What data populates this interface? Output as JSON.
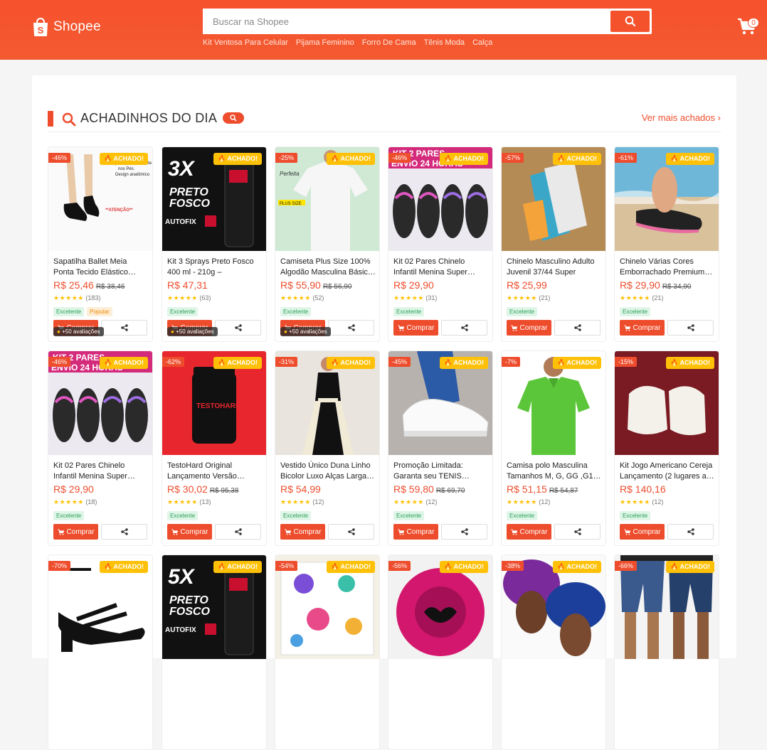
{
  "header": {
    "logo_text": "Shopee",
    "search_placeholder": "Buscar na Shopee",
    "suggestions": [
      "Kit Ventosa Para Celular",
      "Pijama Feminino",
      "Forro De Cama",
      "Tênis Moda",
      "Calça"
    ],
    "cart_count": "0"
  },
  "section": {
    "title": "ACHADINHOS DO DIA",
    "more_link": "Ver mais achados"
  },
  "labels": {
    "buy": "Comprar",
    "achado": "ACHADO!",
    "reviews_badge": "+50 avaliações"
  },
  "colors": {
    "brand": "#ee4d2d",
    "achado": "#ffc107"
  },
  "products": [
    {
      "name": "Sapatilha Ballet Meia Ponta Tecido Elástico…",
      "price": "R$ 25,46",
      "old_price": "R$ 38,46",
      "discount": "-46%",
      "stars": "★★★★★",
      "rating_count": "(183)",
      "tags": [
        "Excelente",
        "Popular"
      ],
      "badge": "+50 avaliações",
      "image": "ballet-slippers-photo"
    },
    {
      "name": "Kit 3 Sprays Preto Fosco 400 ml - 210g – Promoçã…",
      "price": "R$ 47,31",
      "old_price": "",
      "discount": "",
      "stars": "★★★★★",
      "rating_count": "(63)",
      "tags": [
        "Excelente"
      ],
      "badge": "+50 avaliações",
      "image": "spray-3x-photo"
    },
    {
      "name": "Camiseta Plus Size 100% Algodão Masculina Básic…",
      "price": "R$ 55,90",
      "old_price": "R$ 56,90",
      "discount": "-25%",
      "stars": "★★★★★",
      "rating_count": "(52)",
      "tags": [
        "Excelente"
      ],
      "badge": "+50 avaliações",
      "image": "white-tshirt-photo"
    },
    {
      "name": "Kit 02 Pares Chinelo Infantil Menina Super…",
      "price": "R$ 29,90",
      "old_price": "",
      "discount": "-46%",
      "stars": "★★★★★",
      "rating_count": "(31)",
      "tags": [
        "Excelente"
      ],
      "badge": "",
      "image": "kids-flipflops-photo"
    },
    {
      "name": "Chinelo Masculino Adulto Juvenil 37/44 Super Maci…",
      "price": "R$ 25,99",
      "old_price": "",
      "discount": "-57%",
      "stars": "★★★★★",
      "rating_count": "(21)",
      "tags": [
        "Excelente"
      ],
      "badge": "",
      "image": "men-flipflops-photo"
    },
    {
      "name": "Chinelo Várias Cores Emborrachado Premium…",
      "price": "R$ 29,90",
      "old_price": "R$ 34,90",
      "discount": "-61%",
      "stars": "★★★★★",
      "rating_count": "(21)",
      "tags": [
        "Excelente"
      ],
      "badge": "",
      "image": "beach-flipflops-photo"
    },
    {
      "name": "Kit 02 Pares Chinelo Infantil Menina Super…",
      "price": "R$ 29,90",
      "old_price": "",
      "discount": "-46%",
      "stars": "★★★★★",
      "rating_count": "(18)",
      "tags": [
        "Excelente"
      ],
      "badge": "",
      "image": "kids-flipflops-photo"
    },
    {
      "name": "TestoHard Original Lançamento Versão…",
      "price": "R$ 30,02",
      "old_price": "R$ 95,38",
      "discount": "-62%",
      "stars": "★★★★★",
      "rating_count": "(13)",
      "tags": [
        "Excelente"
      ],
      "badge": "",
      "image": "supplement-bottle-photo"
    },
    {
      "name": "Vestido Único Duna Linho Bicolor Luxo Alças Larga…",
      "price": "R$ 54,99",
      "old_price": "",
      "discount": "-31%",
      "stars": "★★★★★",
      "rating_count": "(12)",
      "tags": [
        "Excelente"
      ],
      "badge": "",
      "image": "long-dress-photo"
    },
    {
      "name": "Promoção Limitada: Garanta seu TENIS…",
      "price": "R$ 59,80",
      "old_price": "R$ 69,70",
      "discount": "-45%",
      "stars": "★★★★★",
      "rating_count": "(12)",
      "tags": [
        "Excelente"
      ],
      "badge": "",
      "image": "white-sneakers-photo"
    },
    {
      "name": "Camisa polo Masculina Tamanhos M, G, GG ,G1…",
      "price": "R$ 51,15",
      "old_price": "R$ 54,87",
      "discount": "-7%",
      "stars": "★★★★★",
      "rating_count": "(12)",
      "tags": [
        "Excelente"
      ],
      "badge": "",
      "image": "green-polo-photo"
    },
    {
      "name": "Kit Jogo Americano Cereja Lançamento (2 lugares a…",
      "price": "R$ 140,16",
      "old_price": "",
      "discount": "-15%",
      "stars": "★★★★★",
      "rating_count": "(12)",
      "tags": [
        "Excelente"
      ],
      "badge": "",
      "image": "placemat-set-photo"
    },
    {
      "name": "",
      "price": "",
      "old_price": "",
      "discount": "-70%",
      "stars": "",
      "rating_count": "",
      "tags": [],
      "badge": "",
      "image": "black-sandal-photo"
    },
    {
      "name": "",
      "price": "",
      "old_price": "",
      "discount": "",
      "stars": "",
      "rating_count": "",
      "tags": [],
      "badge": "",
      "image": "spray-5x-photo"
    },
    {
      "name": "",
      "price": "",
      "old_price": "",
      "discount": "-54%",
      "stars": "",
      "rating_count": "",
      "tags": [],
      "badge": "",
      "image": "sticker-sheet-photo"
    },
    {
      "name": "",
      "price": "",
      "old_price": "",
      "discount": "-56%",
      "stars": "",
      "rating_count": "",
      "tags": [],
      "badge": "",
      "image": "satin-bonnet-pink-photo"
    },
    {
      "name": "",
      "price": "",
      "old_price": "",
      "discount": "-38%",
      "stars": "",
      "rating_count": "",
      "tags": [],
      "badge": "",
      "image": "satin-bonnet-models-photo"
    },
    {
      "name": "",
      "price": "",
      "old_price": "",
      "discount": "-66%",
      "stars": "",
      "rating_count": "",
      "tags": [],
      "badge": "",
      "image": "denim-shorts-photo"
    }
  ]
}
